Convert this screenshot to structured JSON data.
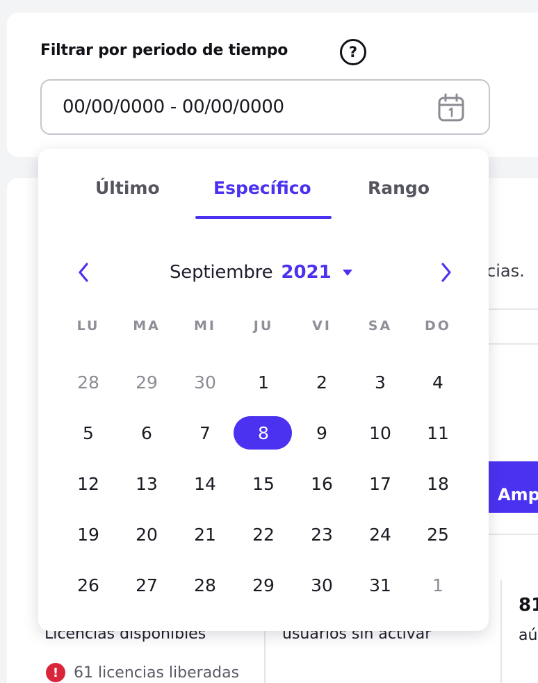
{
  "filter": {
    "title": "Filtrar por periodo de tiempo",
    "help_glyph": "?",
    "date_range_value": "00/00/0000 - 00/00/0000"
  },
  "background": {
    "partial_text": "cias.",
    "button_label": "Amp",
    "stat_value": "81",
    "stat_label_right": "aú",
    "stat_label_left": "Licencias disponibles",
    "stat_label_middle": "usuarios sin activar",
    "alert_glyph": "!",
    "released_text": "61 licencias liberadas"
  },
  "calendar": {
    "tabs": [
      {
        "label": "Último",
        "active": false
      },
      {
        "label": "Específico",
        "active": true
      },
      {
        "label": "Rango",
        "active": false
      }
    ],
    "month": "Septiembre",
    "year": "2021",
    "weekdays": [
      "LU",
      "MA",
      "MI",
      "JU",
      "VI",
      "SA",
      "DO"
    ],
    "weeks": [
      [
        {
          "d": "28",
          "m": true
        },
        {
          "d": "29",
          "m": true
        },
        {
          "d": "30",
          "m": true
        },
        {
          "d": "1"
        },
        {
          "d": "2"
        },
        {
          "d": "3"
        },
        {
          "d": "4"
        }
      ],
      [
        {
          "d": "5"
        },
        {
          "d": "6"
        },
        {
          "d": "7"
        },
        {
          "d": "8",
          "sel": true
        },
        {
          "d": "9"
        },
        {
          "d": "10"
        },
        {
          "d": "11"
        }
      ],
      [
        {
          "d": "12"
        },
        {
          "d": "13"
        },
        {
          "d": "14"
        },
        {
          "d": "15"
        },
        {
          "d": "16"
        },
        {
          "d": "17"
        },
        {
          "d": "18"
        }
      ],
      [
        {
          "d": "19"
        },
        {
          "d": "20"
        },
        {
          "d": "21"
        },
        {
          "d": "22"
        },
        {
          "d": "23"
        },
        {
          "d": "24"
        },
        {
          "d": "25"
        }
      ],
      [
        {
          "d": "26"
        },
        {
          "d": "27"
        },
        {
          "d": "28"
        },
        {
          "d": "29"
        },
        {
          "d": "30"
        },
        {
          "d": "31"
        },
        {
          "d": "1",
          "m": true
        }
      ]
    ],
    "selected_day": "8"
  },
  "colors": {
    "accent": "#4a32f0",
    "alert": "#d9253a"
  },
  "icons": [
    "help-icon",
    "calendar-icon",
    "chevron-left-icon",
    "chevron-right-icon",
    "caret-down-icon",
    "alert-icon"
  ]
}
